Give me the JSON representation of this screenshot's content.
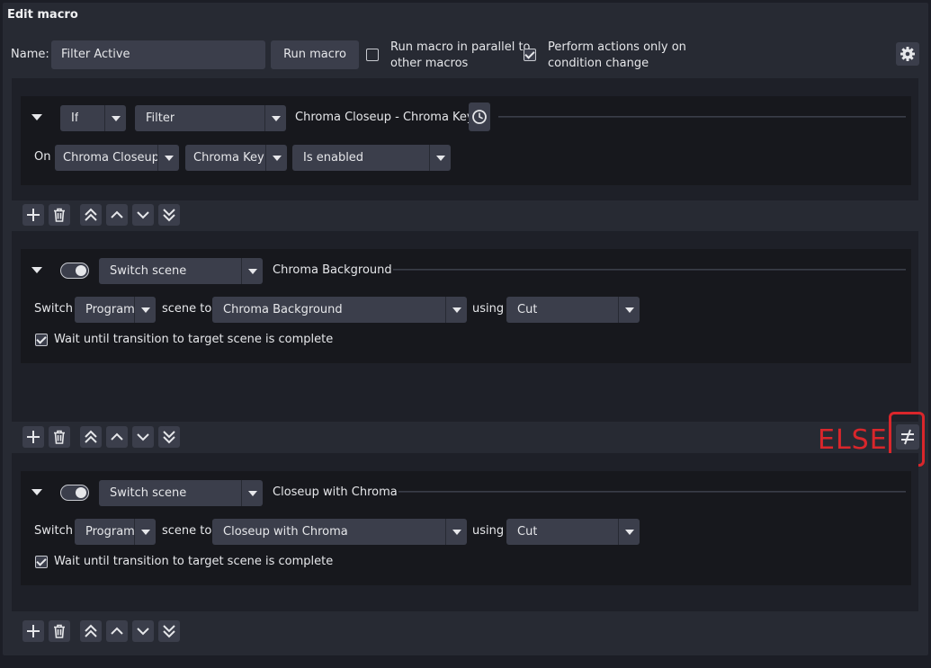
{
  "header": {
    "title": "Edit macro"
  },
  "name_row": {
    "name_label": "Name:",
    "name_value": "Filter Active",
    "run_button": "Run macro",
    "parallel_label_1": "Run macro in parallel to",
    "parallel_label_2": "other macros",
    "parallel_checked": false,
    "perform_label_1": "Perform actions only on",
    "perform_label_2": "condition change",
    "perform_checked": true,
    "settings_icon": "gear-icon"
  },
  "condition": {
    "logic": "If",
    "type": "Filter",
    "summary": "Chroma Closeup - Chroma Key",
    "duration_icon": "clock-icon",
    "on_label": "On",
    "source": "Chroma Closeup",
    "filter": "Chroma Key",
    "state": "Is enabled"
  },
  "actions": [
    {
      "type": "Switch scene",
      "summary": "Chroma Background",
      "switch_label": "Switch",
      "target": "Program",
      "scene_to_label": "scene to",
      "scene": "Chroma Background",
      "using_label": "using",
      "transition": "Cut",
      "wait_label": "Wait until transition to target scene is complete",
      "wait_checked": true
    }
  ],
  "else_actions": [
    {
      "type": "Switch scene",
      "summary": "Closeup with Chroma",
      "switch_label": "Switch",
      "target": "Program",
      "scene_to_label": "scene to",
      "scene": "Closeup with Chroma",
      "using_label": "using",
      "transition": "Cut",
      "wait_label": "Wait until transition to target scene is complete",
      "wait_checked": true
    }
  ],
  "annotation": {
    "else_text": "ELSE",
    "else_icon": "not-equal-icon",
    "color": "#d9262b"
  },
  "toolbar_icons": [
    "add-icon",
    "trash-icon",
    "move-top-icon",
    "move-up-icon",
    "move-down-icon",
    "move-bottom-icon"
  ],
  "colors": {
    "background": "#1c1e26",
    "panel": "#272a33",
    "control": "#3b3e4b",
    "accent_annotation": "#d9262b"
  }
}
